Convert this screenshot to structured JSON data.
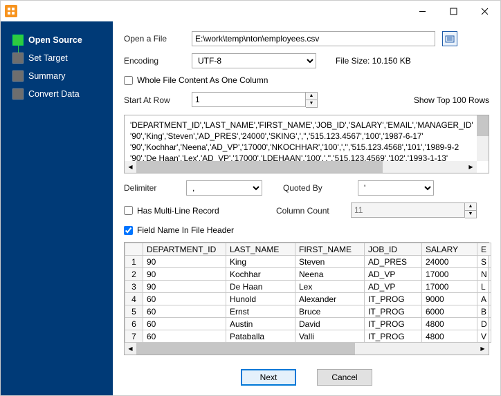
{
  "window": {
    "min": "—",
    "max": "☐",
    "close": "✕"
  },
  "sidebar": {
    "items": [
      {
        "label": "Open Source",
        "active": true
      },
      {
        "label": "Set Target",
        "active": false
      },
      {
        "label": "Summary",
        "active": false
      },
      {
        "label": "Convert Data",
        "active": false
      }
    ]
  },
  "labels": {
    "open_file": "Open a File",
    "encoding": "Encoding",
    "file_size_label": "File Size: 10.150 KB",
    "whole_file": "Whole File Content As One Column",
    "start_row": "Start At Row",
    "show_top": "Show Top 100 Rows",
    "delimiter": "Delimiter",
    "quoted_by": "Quoted By",
    "multiline": "Has Multi-Line Record",
    "col_count": "Column Count",
    "field_header": "Field Name In File Header"
  },
  "values": {
    "file_path": "E:\\work\\temp\\nton\\employees.csv",
    "encoding": "UTF-8",
    "whole_file_checked": false,
    "start_row": "1",
    "delimiter": ",",
    "quoted_by": "'",
    "multiline_checked": false,
    "col_count": "11",
    "field_header_checked": true
  },
  "preview_lines": [
    "'DEPARTMENT_ID','LAST_NAME','FIRST_NAME','JOB_ID','SALARY','EMAIL','MANAGER_ID'",
    "'90','King','Steven','AD_PRES','24000','SKING',','','515.123.4567','100','1987-6-17'",
    "'90','Kochhar','Neena','AD_VP','17000','NKOCHHAR','100',','','515.123.4568','101','1989-9-2",
    "'90','De Haan','Lex','AD_VP','17000','LDEHAAN','100',','','515.123.4569','102','1993-1-13'"
  ],
  "table": {
    "headers": [
      "DEPARTMENT_ID",
      "LAST_NAME",
      "FIRST_NAME",
      "JOB_ID",
      "SALARY",
      "E"
    ],
    "rows": [
      [
        "1",
        "90",
        "King",
        "Steven",
        "AD_PRES",
        "24000",
        "S"
      ],
      [
        "2",
        "90",
        "Kochhar",
        "Neena",
        "AD_VP",
        "17000",
        "N"
      ],
      [
        "3",
        "90",
        "De Haan",
        "Lex",
        "AD_VP",
        "17000",
        "L"
      ],
      [
        "4",
        "60",
        "Hunold",
        "Alexander",
        "IT_PROG",
        "9000",
        "A"
      ],
      [
        "5",
        "60",
        "Ernst",
        "Bruce",
        "IT_PROG",
        "6000",
        "B"
      ],
      [
        "6",
        "60",
        "Austin",
        "David",
        "IT_PROG",
        "4800",
        "D"
      ],
      [
        "7",
        "60",
        "Pataballa",
        "Valli",
        "IT_PROG",
        "4800",
        "V"
      ]
    ]
  },
  "buttons": {
    "next": "Next",
    "cancel": "Cancel"
  }
}
